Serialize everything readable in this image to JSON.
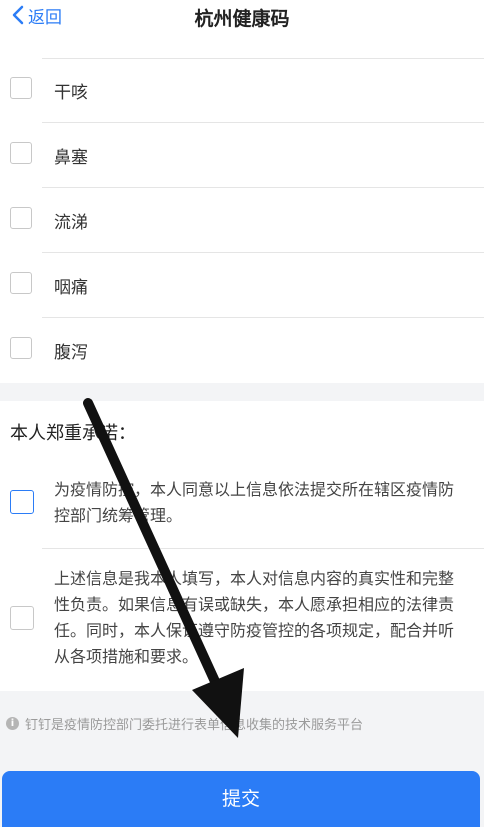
{
  "header": {
    "back_label": "返回",
    "title": "杭州健康码"
  },
  "symptoms": [
    {
      "label": "干咳"
    },
    {
      "label": "鼻塞"
    },
    {
      "label": "流涕"
    },
    {
      "label": "咽痛"
    },
    {
      "label": "腹泻"
    }
  ],
  "commitment": {
    "title": "本人郑重承诺：",
    "items": [
      {
        "text": "为疫情防控，本人同意以上信息依法提交所在辖区疫情防控部门统筹管理。",
        "checked_highlight": true
      },
      {
        "text": "上述信息是我本人填写，本人对信息内容的真实性和完整性负责。如果信息有误或缺失，本人愿承担相应的法律责任。同时，本人保证遵守防疫管控的各项规定，配合并听从各项措施和要求。",
        "checked_highlight": false
      }
    ]
  },
  "footer": {
    "notice": "钉钉是疫情防控部门委托进行表单信息收集的技术服务平台",
    "info_icon": "info-circle-icon",
    "submit_label": "提交"
  },
  "colors": {
    "accent": "#2b7cf6",
    "background_gray": "#f3f4f6"
  }
}
